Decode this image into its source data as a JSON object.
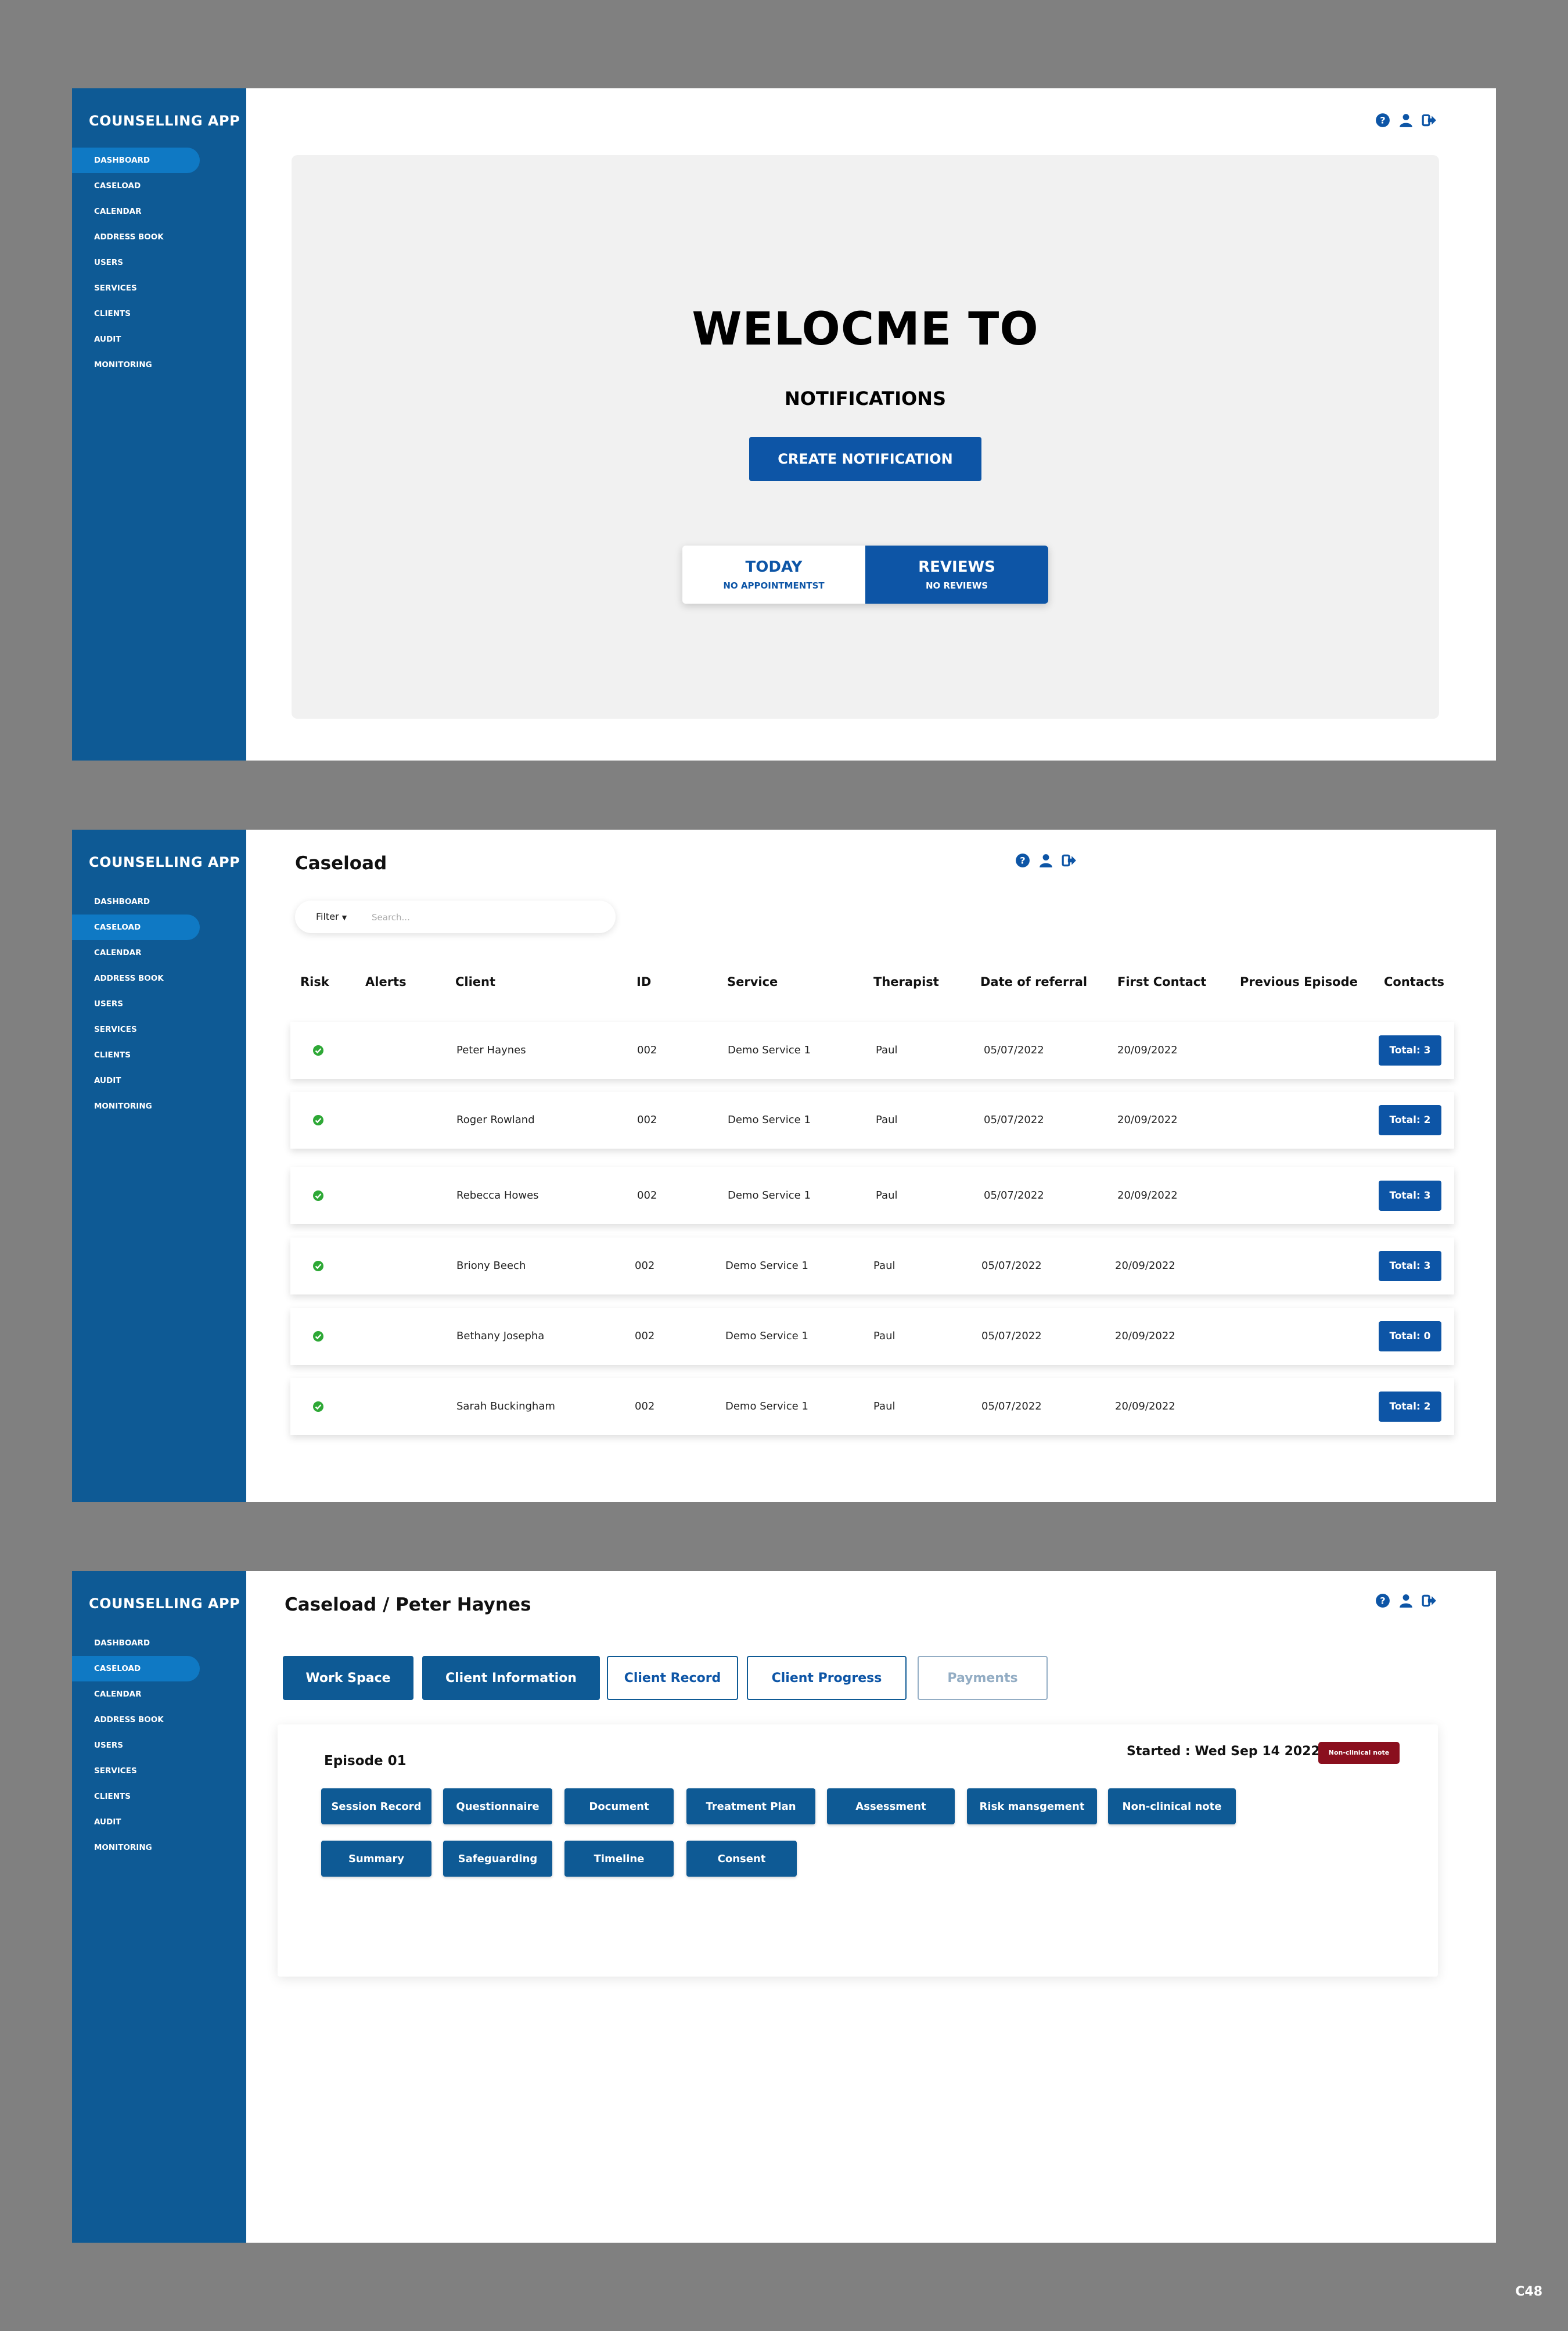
{
  "app_title": "COUNSELLING APP",
  "nav_items": [
    "DASHBOARD",
    "CASELOAD",
    "CALENDAR",
    "ADDRESS BOOK",
    "USERS",
    "SERVICES",
    "CLIENTS",
    "AUDIT",
    "MONITORING"
  ],
  "icons": [
    "help-icon",
    "user-icon",
    "logout-icon"
  ],
  "colors": {
    "sidebar": "#0e5a95",
    "nav_active": "#0f79c4",
    "primary": "#0d55a6",
    "danger": "#8a0f1e",
    "success": "#2ea836"
  },
  "dashboard": {
    "active_nav": "DASHBOARD",
    "welcome_title": "WELOCME TO",
    "welcome_subtitle": "NOTIFICATIONS",
    "create_button": "CREATE NOTIFICATION",
    "today_title": "TODAY",
    "today_sub": "NO APPOINTMENTST",
    "reviews_title": "REVIEWS",
    "reviews_sub": "NO REVIEWS"
  },
  "caseload": {
    "active_nav": "CASELOAD",
    "title": "Caseload",
    "filter_label": "Filter",
    "search_placeholder": "Search...",
    "columns": [
      "Risk",
      "Alerts",
      "Client",
      "ID",
      "Service",
      "Therapist",
      "Date of referral",
      "First Contact",
      "Previous Episode",
      "Contacts"
    ],
    "rows": [
      {
        "client": "Peter Haynes",
        "id": "002",
        "service": "Demo Service 1",
        "therapist": "Paul",
        "referral": "05/07/2022",
        "first_contact": "20/09/2022",
        "contacts": "Total: 3"
      },
      {
        "client": "Roger Rowland",
        "id": "002",
        "service": "Demo Service 1",
        "therapist": "Paul",
        "referral": "05/07/2022",
        "first_contact": "20/09/2022",
        "contacts": "Total: 2"
      },
      {
        "client": "Rebecca Howes",
        "id": "002",
        "service": "Demo Service 1",
        "therapist": "Paul",
        "referral": "05/07/2022",
        "first_contact": "20/09/2022",
        "contacts": "Total: 3"
      },
      {
        "client": "Briony Beech",
        "id": "002",
        "service": "Demo Service 1",
        "therapist": "Paul",
        "referral": "05/07/2022",
        "first_contact": "20/09/2022",
        "contacts": "Total: 3"
      },
      {
        "client": "Bethany Josepha",
        "id": "002",
        "service": "Demo Service 1",
        "therapist": "Paul",
        "referral": "05/07/2022",
        "first_contact": "20/09/2022",
        "contacts": "Total: 0"
      },
      {
        "client": "Sarah Buckingham",
        "id": "002",
        "service": "Demo Service 1",
        "therapist": "Paul",
        "referral": "05/07/2022",
        "first_contact": "20/09/2022",
        "contacts": "Total: 2"
      }
    ]
  },
  "client": {
    "active_nav": "CASELOAD",
    "breadcrumb": "Caseload /  Peter Haynes",
    "tabs": [
      "Work Space",
      "Client Information",
      "Client Record",
      "Client Progress",
      "Payments"
    ],
    "episode_title": "Episode 01",
    "started": "Started : Wed Sep 14 2022",
    "badge": "Non-clinical note",
    "actions_row1": [
      "Session Record",
      "Questionnaire",
      "Document",
      "Treatment Plan",
      "Assessment",
      "Risk mansgement",
      "Non-clinical note"
    ],
    "actions_row2": [
      "Summary",
      "Safeguarding",
      "Timeline",
      "Consent"
    ]
  },
  "page_code": "C48"
}
